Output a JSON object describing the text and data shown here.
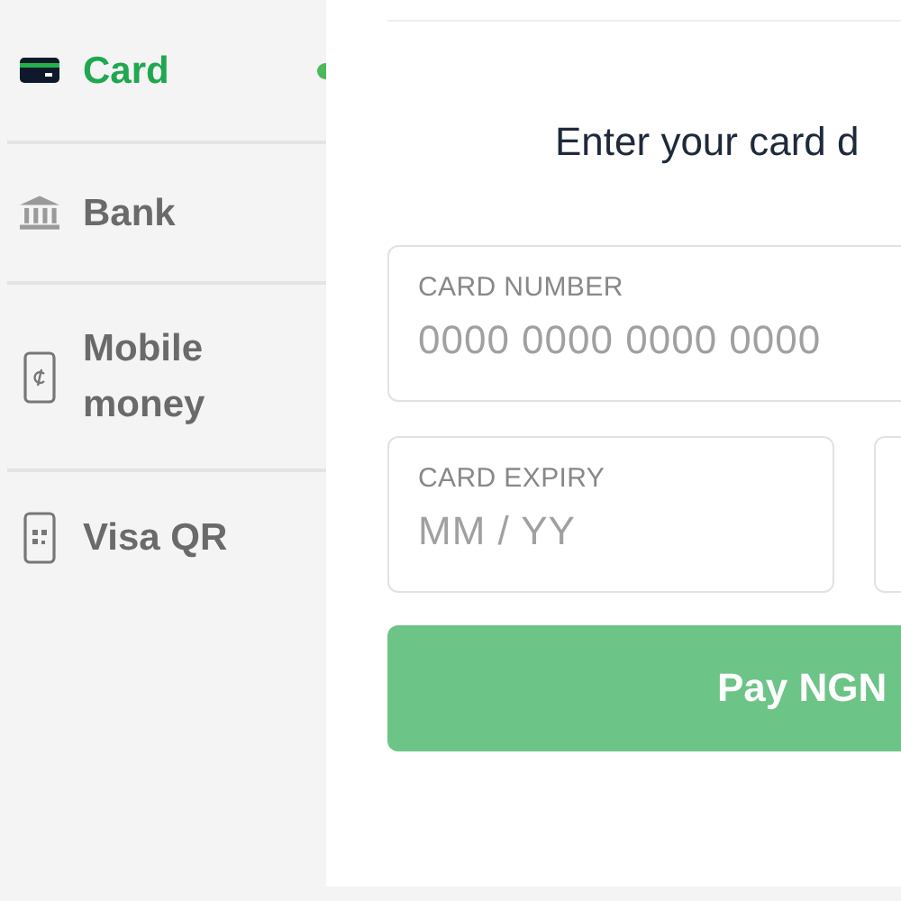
{
  "sidebar": {
    "items": [
      {
        "label": "Card",
        "kind": "card",
        "selected": true
      },
      {
        "label": "Bank",
        "kind": "bank",
        "selected": false
      },
      {
        "label": "Mobile money",
        "kind": "mobile",
        "selected": false
      },
      {
        "label": "Visa QR",
        "kind": "qr",
        "selected": false
      }
    ]
  },
  "form": {
    "heading": "Enter your card d",
    "fields": [
      {
        "kind": "full",
        "label": "CARD NUMBER",
        "placeholder": "0000 0000 0000 0000"
      },
      {
        "kind": "half",
        "label": "CARD EXPIRY",
        "placeholder": "MM / YY"
      },
      {
        "kind": "half"
      }
    ],
    "pay_button": "Pay NGN"
  }
}
